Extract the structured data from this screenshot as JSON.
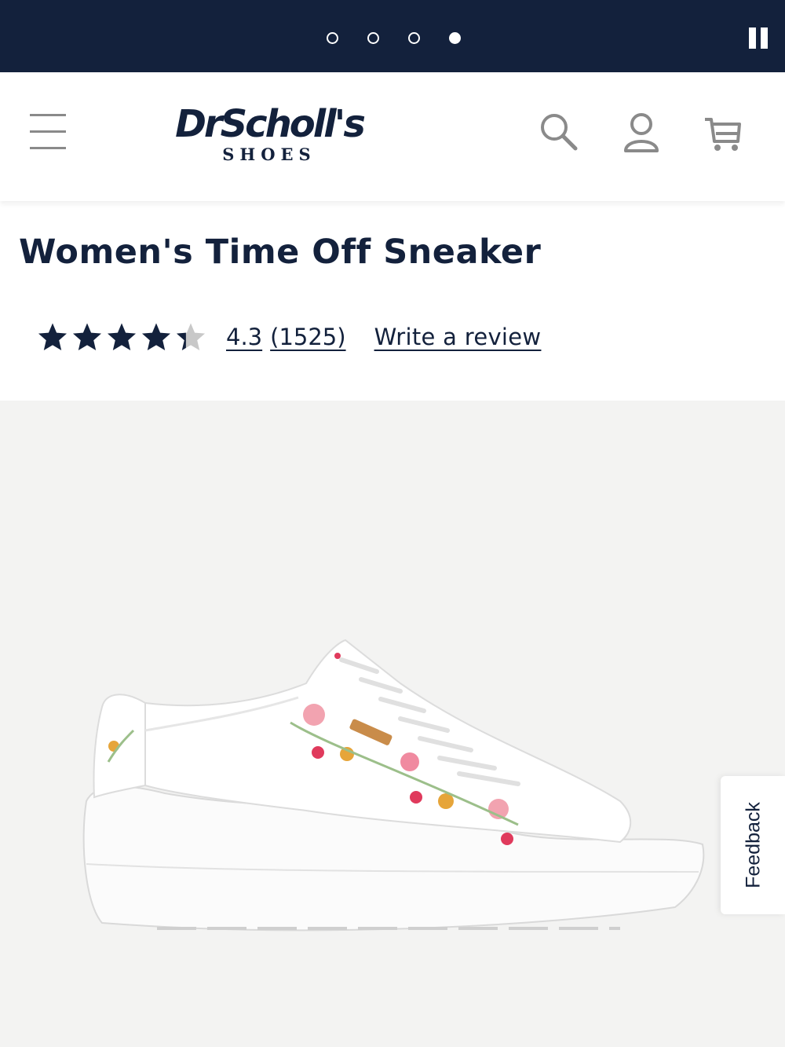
{
  "colors": {
    "navy": "#13213c",
    "header_bg": "#ffffff",
    "image_bg": "#f3f3f2",
    "icon_gray": "#8a8a8a",
    "star_empty": "#c8c8c8"
  },
  "promo_banner": {
    "slide_count": 4,
    "active_slide": 4,
    "pause_icon": "pause-icon"
  },
  "header": {
    "menu_icon": "hamburger-menu-icon",
    "logo_main": "DrScholl's",
    "logo_sub": "SHOES",
    "search_icon": "search-icon",
    "account_icon": "account-icon",
    "cart_icon": "cart-icon"
  },
  "product": {
    "title": "Women's Time Off Sneaker",
    "rating_value": 4.3,
    "rating_max": 5,
    "rating_text": "4.3",
    "review_count_text": "(1525)",
    "write_review_label": "Write a review",
    "image_alt": "White embroidered floral platform sneaker"
  },
  "feedback_tab": {
    "label": "Feedback"
  }
}
